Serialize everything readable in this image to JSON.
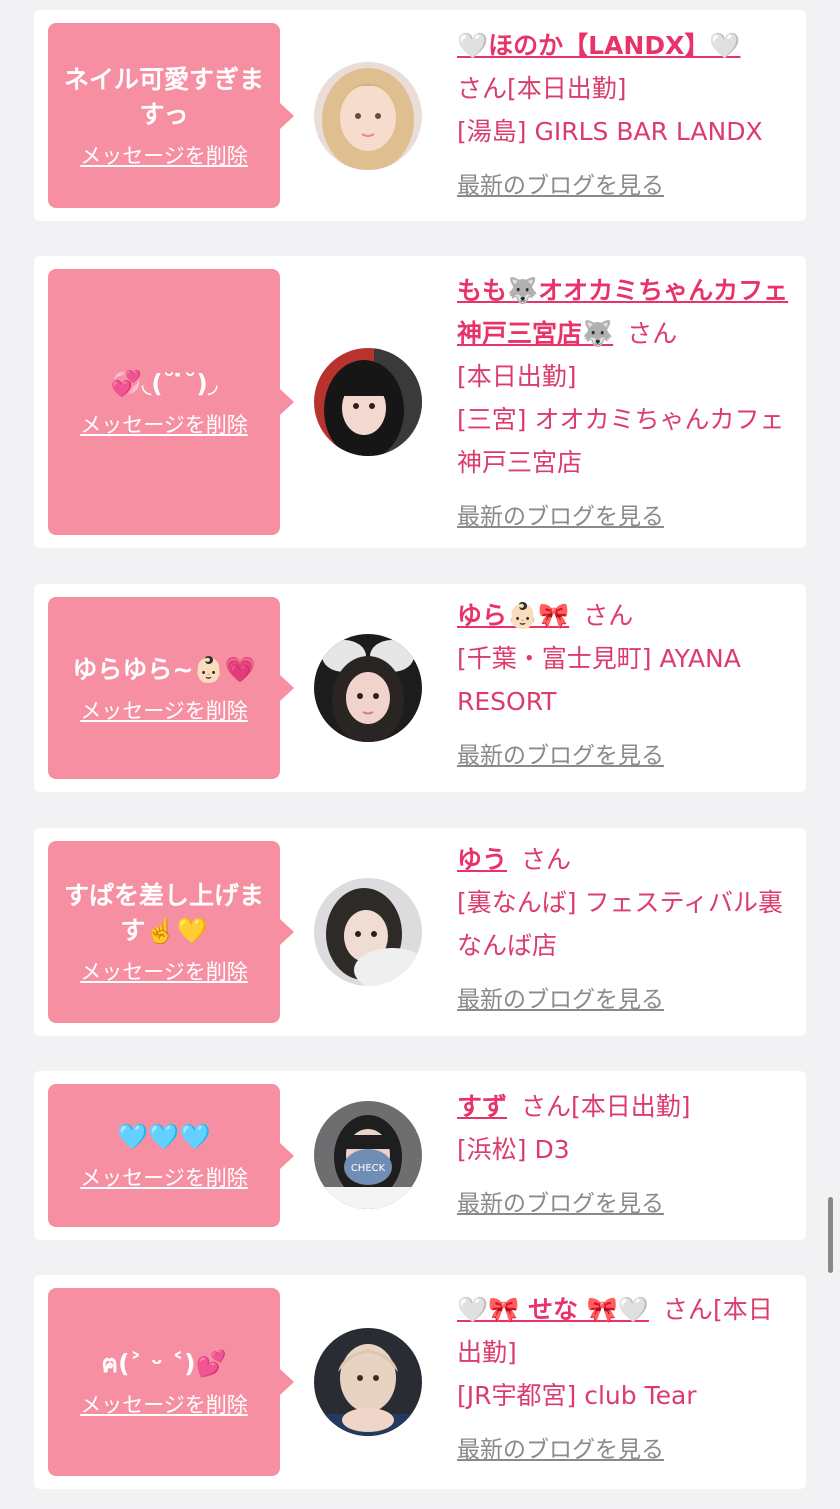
{
  "entries": [
    {
      "message": "ネイル可愛すぎますっ",
      "delete_label": "メッセージを削除",
      "name": "🤍ほのか【LANDX】🤍",
      "san": "さん",
      "status": "[本日出勤]",
      "shop": "[湯島] GIRLS BAR LANDX",
      "blog_label": "最新のブログを見る"
    },
    {
      "message": "💞◟(˘ ̇˘)◞",
      "delete_label": "メッセージを削除",
      "name": "もも🐺オオカミちゃんカフェ神戸三宮店🐺",
      "san": "さん",
      "status": "[本日出勤]",
      "shop": "[三宮] オオカミちゃんカフェ神戸三宮店",
      "blog_label": "最新のブログを見る"
    },
    {
      "message": "ゆらゆら~👶🏻💗",
      "delete_label": "メッセージを削除",
      "name": "ゆら👶🏻🎀",
      "san": "さん",
      "status": "",
      "shop": "[千葉・富士見町] AYANA RESORT",
      "blog_label": "最新のブログを見る"
    },
    {
      "message": "すぱを差し上げます☝️💛",
      "delete_label": "メッセージを削除",
      "name": "ゆう",
      "san": "さん",
      "status": "",
      "shop": "[裏なんば] フェスティバル裏なんば店",
      "blog_label": "最新のブログを見る"
    },
    {
      "message": "🩵🩵🩵",
      "delete_label": "メッセージを削除",
      "name": "すず",
      "san": "さん",
      "status": "[本日出勤]",
      "shop": "[浜松] D3",
      "blog_label": "最新のブログを見る",
      "avatar_badge": "CHECK"
    },
    {
      "message": "ฅ(˃ ᵕ ˂)💕",
      "delete_label": "メッセージを削除",
      "name": "🤍🎀 せな 🎀🤍",
      "san": "さん",
      "status": "[本日出勤]",
      "shop": "[JR宇都宮] club Tear",
      "blog_label": "最新のブログを見る"
    }
  ],
  "colors": {
    "page_bg": "#f2f2f5",
    "bubble": "#f78fa3",
    "name": "#e8336a",
    "text": "#dc3c6c",
    "blog_link": "#8a8a8a"
  }
}
